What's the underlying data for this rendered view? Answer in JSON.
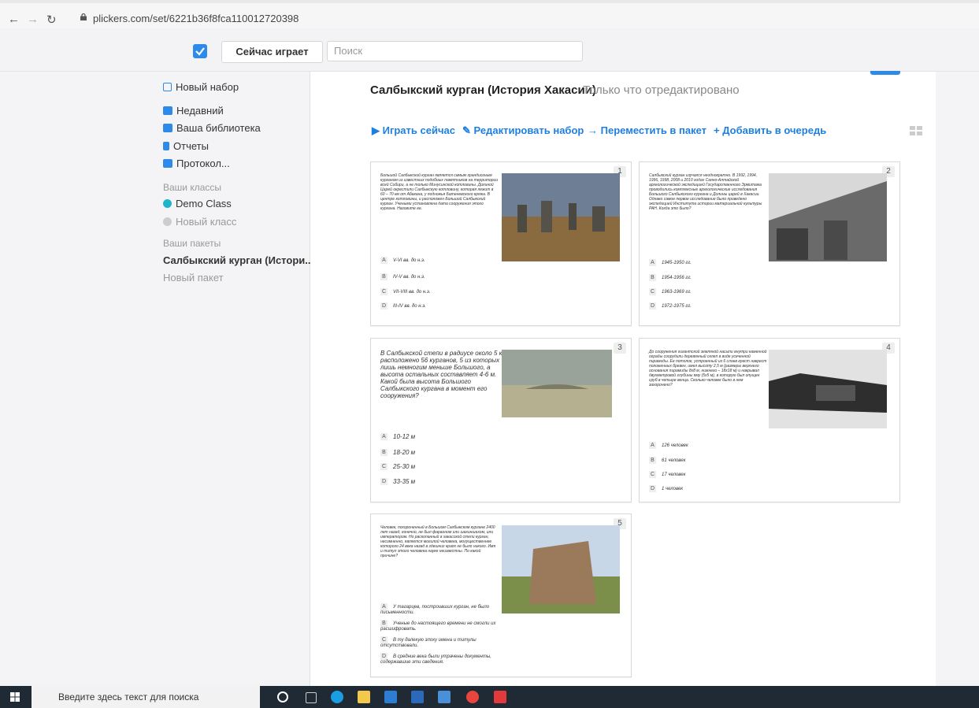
{
  "browser": {
    "url": "plickers.com/set/6221b36f8fca110012720398"
  },
  "appbar": {
    "now_playing": "Сейчас играет",
    "search_placeholder": "Поиск"
  },
  "sidebar": {
    "new_set": "Новый набор",
    "recent": "Недавний",
    "library": "Ваша библиотека",
    "reports": "Отчеты",
    "protocol": "Протокол...",
    "classes_header": "Ваши классы",
    "classes": [
      "Demo Class",
      "Новый класс"
    ],
    "packs_header": "Ваши пакеты",
    "packs": [
      "Салбыкский курган (Истори...",
      "Новый пакет"
    ]
  },
  "header": {
    "title": "Салбыкский курган (История Хакасии)",
    "status": "Только что отредактировано"
  },
  "actions": {
    "play": "Играть сейчас",
    "edit": "Редактировать набор",
    "move": "Переместить в пакет",
    "queue": "Добавить в очередь"
  },
  "questions": [
    {
      "num": "1",
      "text": "Большой Салбыкский курган является самым грандиозным курганом из известных подобных памятников на территории всей Сибири, а не только Минусинской котловины. Долиной Царей окрестили Салбыкскую котловину, которая лежит в 60 – 70 км от Абакана, у подножья Батеневского кряжа. В центре котловины, и расположен Большой Салбыкский курган. Учеными установлена дата сооружения этого кургана. Назовите ее.",
      "options": [
        "V-VI вв. до н.э.",
        "IV-V вв. до н.э.",
        "VII-VIII вв. до н.э.",
        "III-IV вв. до н.э."
      ]
    },
    {
      "num": "2",
      "text": "Салбыкский курган изучался неоднократно. В 1992, 1994, 1996, 1998, 2008 и 2010 годах Саяно-Алтайской археологической экспедицией Государственного Эрмитажа проводились комплексные археологические исследования Большого Салбыкского кургана и Долины царей в Хакасии. Однако самое первое исследование было проведено экспедицией Института истории материальной культуры РАН. Когда это было?",
      "options": [
        "1945-1950 гг.",
        "1954-1956 гг.",
        "1963-1969 гг.",
        "1972-1975 гг."
      ]
    },
    {
      "num": "3",
      "text": "В Салбыкской степи в радиусе около 5 км расположено 56 курганов, 5 из которых лишь немногим меньше Большого, а высота остальных составляет 4-6 м. Какой была высота Большого Салбыкского кургана в момент его сооружения?",
      "options": [
        "10-12 м",
        "18-20 м",
        "25-30 м",
        "33-35 м"
      ]
    },
    {
      "num": "4",
      "text": "До сооружения гигантской земляной насыпи внутри каменной ограды соорудили деревянный склеп в виде усеченной пирамиды. Ее потолок, устроенный из 6 слоев крест накрест положенных бревен, имел высоту 2,5 м (размеры верхнего основания пирамиды 8х8 м, нижнего – 18х18 м) и накрывал двухметровой глубины яму (5х5 м), в которую был опущен сруб в четыре венца. Сколько человек было в нем захоронено?",
      "options": [
        "126 человек",
        "61 человек",
        "17 человек",
        "1 человек"
      ]
    },
    {
      "num": "5",
      "text": "Человек, похороненный в Большом Салбыкском кургане 2400 лет назад, конечно, не был фараоном или шахиншахом, или императором. Но раскопанный в хакасской степи курган, несомненно, является могилой человека, могущественнее которого 24 века назад в здешних краях не было никого. Имя и титул этого человека науке неизвестны. По какой причине?",
      "options": [
        "У тагарцев, построивших курган, не было письменности.",
        "Ученые до настоящего времени не смогли их расшифровать.",
        "В ту далекую эпоху имена и титулы отсутствовали.",
        "В средние века были утрачены документы, содержавшие эти сведения."
      ]
    }
  ],
  "taskbar": {
    "search_placeholder": "Введите здесь текст для поиска"
  }
}
